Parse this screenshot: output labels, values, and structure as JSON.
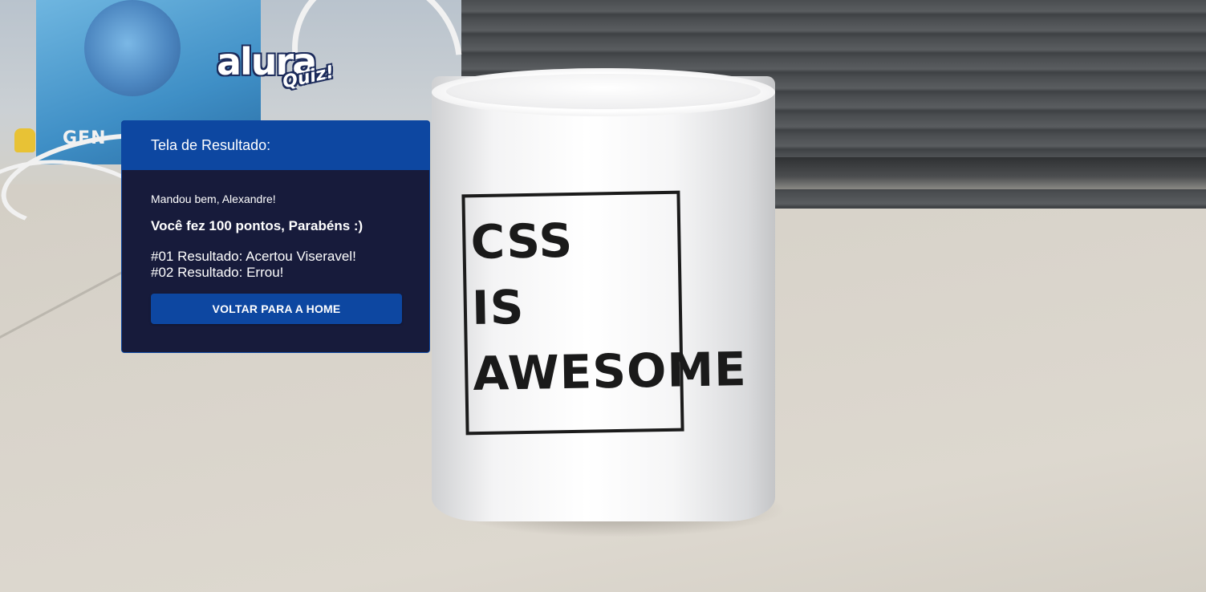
{
  "brand": {
    "logo_main": "alura",
    "logo_sub": "Quiz!"
  },
  "background": {
    "box_label": "GEN",
    "mug_lines": [
      "CSS",
      "IS",
      "AWESOME"
    ]
  },
  "result_card": {
    "title": "Tela de Resultado:",
    "greeting": "Mandou bem, Alexandre!",
    "score_text": "Você fez 100 pontos, Parabéns :)",
    "results": [
      "#01 Resultado: Acertou Viseravel!",
      "#02 Resultado: Errou!"
    ],
    "home_button_label": "VOLTAR PARA A HOME"
  },
  "colors": {
    "primary": "#0d47a1",
    "card_background": "#171b3b",
    "text": "#ffffff"
  }
}
